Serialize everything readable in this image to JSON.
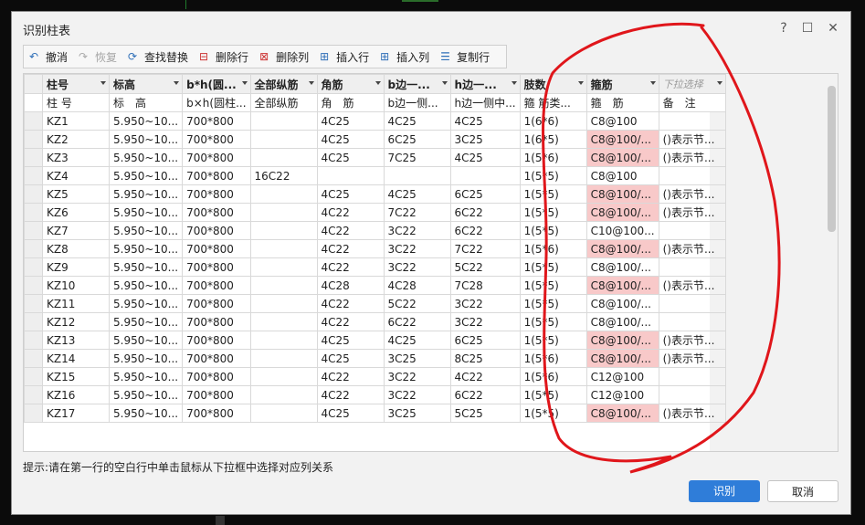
{
  "dialog": {
    "title": "识别柱表"
  },
  "window_controls": {
    "help": "?",
    "maximize": "☐",
    "close": "✕"
  },
  "toolbar": {
    "items": [
      {
        "label": "撤消",
        "icon": "undo-icon",
        "enabled": true
      },
      {
        "label": "恢复",
        "icon": "redo-icon",
        "enabled": false
      },
      {
        "label": "查找替换",
        "icon": "find-replace-icon",
        "enabled": true
      },
      {
        "label": "删除行",
        "icon": "delete-row-icon",
        "enabled": true
      },
      {
        "label": "删除列",
        "icon": "delete-column-icon",
        "enabled": true
      },
      {
        "label": "插入行",
        "icon": "insert-row-icon",
        "enabled": true
      },
      {
        "label": "插入列",
        "icon": "insert-column-icon",
        "enabled": true
      },
      {
        "label": "复制行",
        "icon": "copy-row-icon",
        "enabled": true
      }
    ]
  },
  "table": {
    "header_select": [
      "柱号",
      "标高",
      "b*h(圆...",
      "全部纵筋",
      "角筋",
      "b边一...",
      "h边一...",
      "肢数",
      "箍筋",
      "下拉选择"
    ],
    "header_original": [
      "柱 号",
      "标　高",
      "b×h(圆柱...",
      "全部纵筋",
      "角　筋",
      "b边一侧...",
      "h边一侧中...",
      "箍 筋类...",
      "箍　筋",
      "备　注"
    ],
    "rows": [
      [
        "KZ1",
        "5.950~10...",
        "700*800",
        "",
        "4C25",
        "4C25",
        "4C25",
        "1(6*6)",
        "C8@100",
        ""
      ],
      [
        "KZ2",
        "5.950~10...",
        "700*800",
        "",
        "4C25",
        "6C25",
        "3C25",
        "1(6*5)",
        "C8@100/...",
        "()表示节..."
      ],
      [
        "KZ3",
        "5.950~10...",
        "700*800",
        "",
        "4C25",
        "7C25",
        "4C25",
        "1(5*6)",
        "C8@100/...",
        "()表示节..."
      ],
      [
        "KZ4",
        "5.950~10...",
        "700*800",
        "16C22",
        "",
        "",
        "",
        "1(5*5)",
        "C8@100",
        ""
      ],
      [
        "KZ5",
        "5.950~10...",
        "700*800",
        "",
        "4C25",
        "4C25",
        "6C25",
        "1(5*5)",
        "C8@100/...",
        "()表示节..."
      ],
      [
        "KZ6",
        "5.950~10...",
        "700*800",
        "",
        "4C22",
        "7C22",
        "6C22",
        "1(5*5)",
        "C8@100/...",
        "()表示节..."
      ],
      [
        "KZ7",
        "5.950~10...",
        "700*800",
        "",
        "4C22",
        "3C22",
        "6C22",
        "1(5*5)",
        "C10@100...",
        ""
      ],
      [
        "KZ8",
        "5.950~10...",
        "700*800",
        "",
        "4C22",
        "3C22",
        "7C22",
        "1(5*6)",
        "C8@100/...",
        "()表示节..."
      ],
      [
        "KZ9",
        "5.950~10...",
        "700*800",
        "",
        "4C22",
        "3C22",
        "5C22",
        "1(5*5)",
        "C8@100/...",
        ""
      ],
      [
        "KZ10",
        "5.950~10...",
        "700*800",
        "",
        "4C28",
        "4C28",
        "7C28",
        "1(5*5)",
        "C8@100/...",
        "()表示节..."
      ],
      [
        "KZ11",
        "5.950~10...",
        "700*800",
        "",
        "4C22",
        "5C22",
        "3C22",
        "1(5*5)",
        "C8@100/...",
        ""
      ],
      [
        "KZ12",
        "5.950~10...",
        "700*800",
        "",
        "4C22",
        "6C22",
        "3C22",
        "1(5*5)",
        "C8@100/...",
        ""
      ],
      [
        "KZ13",
        "5.950~10...",
        "700*800",
        "",
        "4C25",
        "4C25",
        "6C25",
        "1(5*5)",
        "C8@100/...",
        "()表示节..."
      ],
      [
        "KZ14",
        "5.950~10...",
        "700*800",
        "",
        "4C25",
        "3C25",
        "8C25",
        "1(5*6)",
        "C8@100/...",
        "()表示节..."
      ],
      [
        "KZ15",
        "5.950~10...",
        "700*800",
        "",
        "4C22",
        "3C22",
        "4C22",
        "1(5*6)",
        "C12@100",
        ""
      ],
      [
        "KZ16",
        "5.950~10...",
        "700*800",
        "",
        "4C22",
        "3C22",
        "6C22",
        "1(5*5)",
        "C12@100",
        ""
      ],
      [
        "KZ17",
        "5.950~10...",
        "700*800",
        "",
        "4C25",
        "3C25",
        "5C25",
        "1(5*5)",
        "C8@100/...",
        "()表示节..."
      ]
    ],
    "pink_rows": [
      1,
      2,
      4,
      5,
      7,
      9,
      12,
      13,
      16
    ]
  },
  "hint": "提示:请在第一行的空白行中单击鼠标从下拉框中选择对应列关系",
  "buttons": {
    "ok": "识别",
    "cancel": "取消"
  },
  "colors": {
    "accent": "#2f7dd9",
    "highlight": "#f8c9c9",
    "annotation": "#e0161b"
  }
}
